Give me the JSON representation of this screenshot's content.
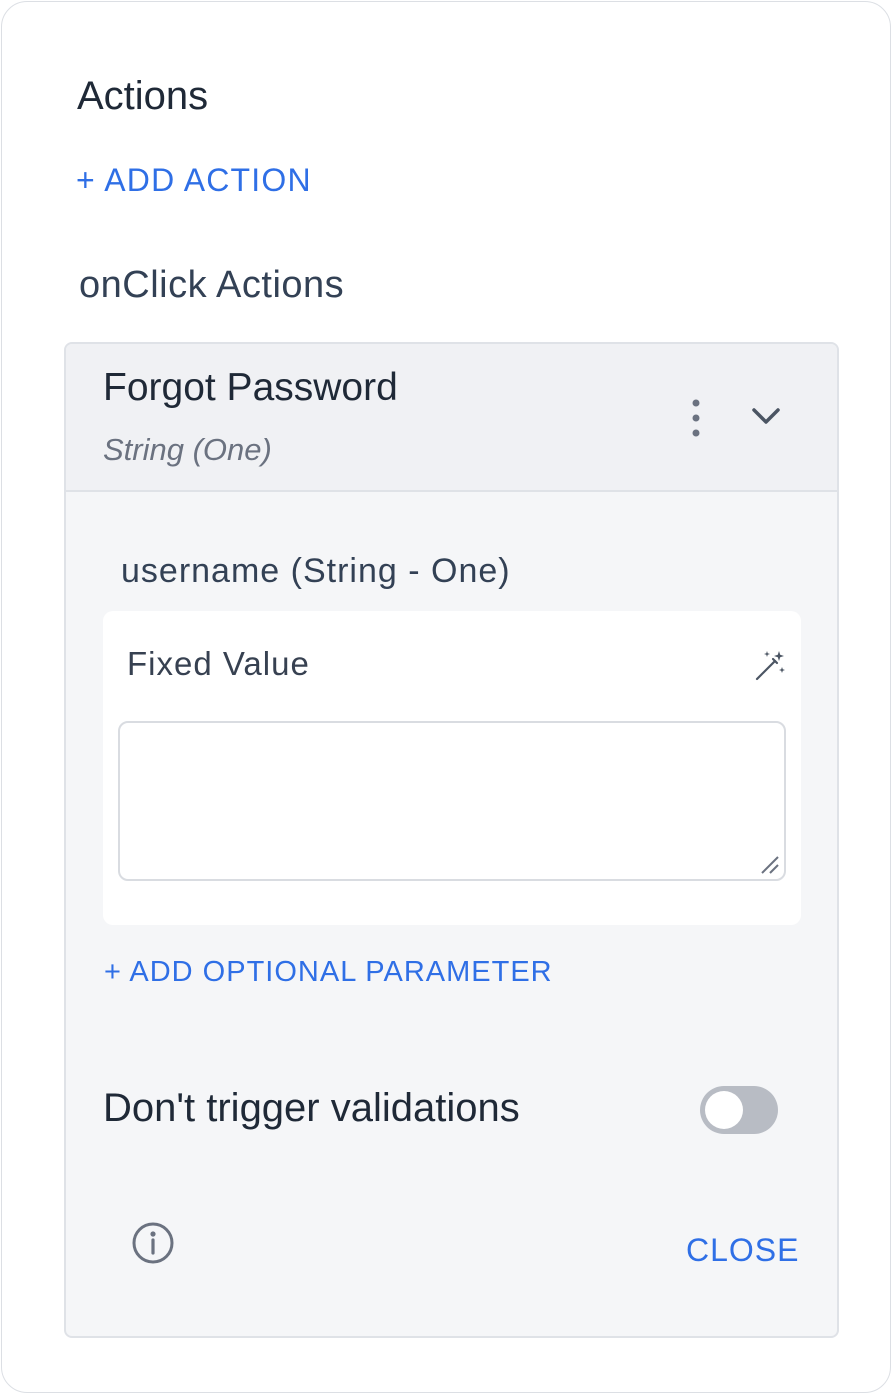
{
  "actions": {
    "title": "Actions",
    "add_action_label": "+ ADD ACTION",
    "onclick_title": "onClick Actions"
  },
  "card": {
    "title": "Forgot Password",
    "subtitle": "String (One)",
    "parameter": {
      "label": "username (String - One)",
      "value_type_label": "Fixed Value",
      "value": ""
    },
    "add_optional_parameter_label": "+ ADD OPTIONAL PARAMETER",
    "toggle": {
      "label": "Don't trigger validations",
      "enabled": false
    },
    "close_label": "CLOSE"
  },
  "icons": {
    "menu": "kebab-menu-icon",
    "collapse": "chevron-down-icon",
    "variable": "magic-wand-icon",
    "info": "info-icon"
  },
  "colors": {
    "accent": "#2f6fe6",
    "toggle_off": "#b8bcc4"
  }
}
